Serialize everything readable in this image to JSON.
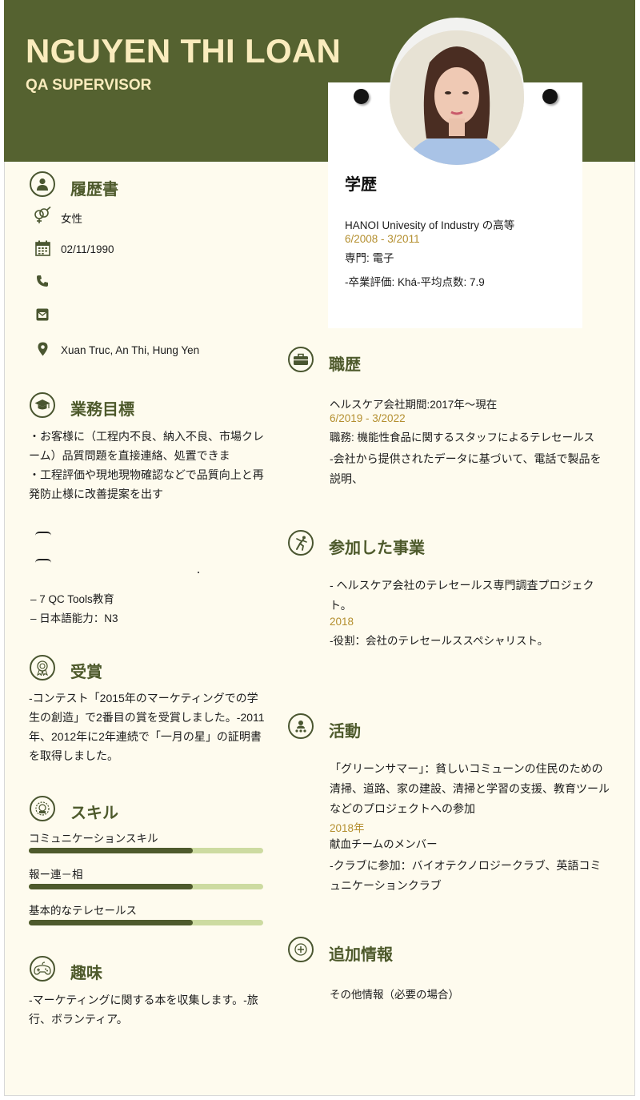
{
  "header": {
    "name": "NGUYEN THI LOAN",
    "role": "QA SUPERVISOR"
  },
  "personal": {
    "title": "履歴書",
    "gender": "女性",
    "birthdate": "02/11/1990",
    "phone": "",
    "email": "",
    "address": "Xuan Truc, An Thi, Hung Yen"
  },
  "objective": {
    "title": "業務目標",
    "lines": [
      "・お客様に（工程内不良、納入不良、市場クレ",
      "ーム）品質問題を直接連絡、処置できま",
      "・工程評価や現地現物確認などで品質向上と再",
      "発防止様に改善提案を出す"
    ]
  },
  "certificates": {
    "items": [
      "– 7 QC Tools教育",
      "– 日本語能力：N3"
    ]
  },
  "awards": {
    "title": "受賞",
    "lines": [
      "-コンテスト「2015年のマーケティングでの学",
      "生の創造」で2番目の賞を受賞しました。-2011",
      "年、2012年に2年連続で「一月の星」の証明書",
      "を取得しました。"
    ]
  },
  "skills": {
    "title": "スキル",
    "items": [
      {
        "label": "コミュニケーションスキル",
        "level": 0.7
      },
      {
        "label": "報ー連－相",
        "level": 0.7
      },
      {
        "label": "基本的なテレセールス",
        "level": 0.7
      }
    ]
  },
  "hobbies": {
    "title": "趣味",
    "lines": [
      "-マーケティングに関する本を収集します。-旅",
      "行、ボランティア。"
    ]
  },
  "education": {
    "title": "学歴",
    "school": "HANOI Univesity of Industry の高等",
    "dates": "6/2008 - 3/2011",
    "major": "専門: 電子",
    "grade": "-卒業評価: Khá-平均点数: 7.9"
  },
  "experience": {
    "title": "職歴",
    "company": "ヘルスケア会社期間:2017年～現在",
    "dates": "6/2019 - 3/2022",
    "position": "職務: 機能性食品に関するスタッフによるテレセールス",
    "desc_lines": [
      "-会社から提供されたデータに基づいて、電話で製品を",
      "説明、"
    ]
  },
  "projects": {
    "title": "参加した事業",
    "lines": [
      "- ヘルスケア会社のテレセールス専門調査プロジェク",
      "ト。"
    ],
    "year": "2018",
    "role": "-役割：会社のテレセールススペシャリスト。"
  },
  "activities": {
    "title": "活動",
    "lines": [
      "「グリーンサマー」：貧しいコミューンの住民のための",
      "清掃、道路、家の建設、清掃と学習の支援、教育ツール",
      "などのプロジェクトへの参加"
    ],
    "year": "2018年",
    "member": "献血チームのメンバー",
    "club_lines": [
      "-クラブに参加：バイオテクノロジークラブ、英語コミ",
      "ュニケーションクラブ"
    ]
  },
  "additional": {
    "title": "追加情報",
    "text": "その他情報（必要の場合）"
  },
  "colors": {
    "header_bg": "#556230",
    "header_text": "#faecbd",
    "accent": "#4e5a2c",
    "date": "#b48f2f",
    "page_bg": "#fefbee",
    "bar_track": "#cddba1"
  }
}
